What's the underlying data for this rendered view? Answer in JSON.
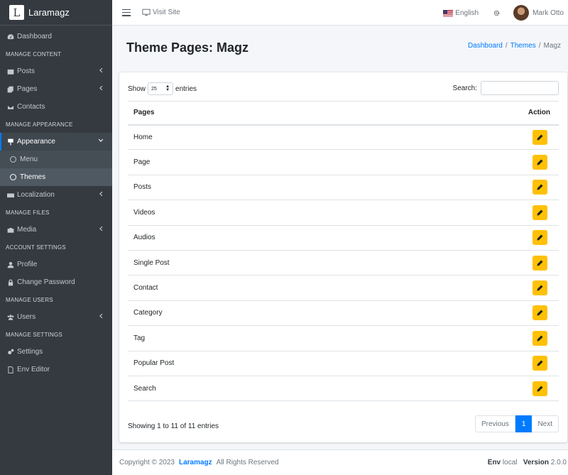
{
  "brand": {
    "logo_letter": "L",
    "name": "Laramagz"
  },
  "sidebar": {
    "dashboard": "Dashboard",
    "manage_content": "MANAGE CONTENT",
    "posts": "Posts",
    "pages": "Pages",
    "contacts": "Contacts",
    "manage_appearance": "MANAGE APPEARANCE",
    "appearance": "Appearance",
    "menu": "Menu",
    "themes": "Themes",
    "localization": "Localization",
    "manage_files": "MANAGE FILES",
    "media": "Media",
    "account_settings": "ACCOUNT SETTINGS",
    "profile": "Profile",
    "change_password": "Change Password",
    "manage_users": "MANAGE USERS",
    "users": "Users",
    "manage_settings": "MANAGE SETTINGS",
    "settings": "Settings",
    "env_editor": "Env Editor"
  },
  "topbar": {
    "visit_site": "Visit Site",
    "language": "English",
    "user_name": "Mark Otto"
  },
  "header": {
    "title": "Theme Pages: Magz",
    "breadcrumb": [
      "Dashboard",
      "Themes",
      "Magz"
    ],
    "breadcrumb_sep": "/"
  },
  "table": {
    "show_label": "Show",
    "entries_value": "25",
    "entries_label": "entries",
    "search_label": "Search:",
    "columns": [
      "Pages",
      "Action"
    ],
    "rows": [
      "Home",
      "Page",
      "Posts",
      "Videos",
      "Audios",
      "Single Post",
      "Contact",
      "Category",
      "Tag",
      "Popular Post",
      "Search"
    ],
    "info": "Showing 1 to 11 of 11 entries",
    "pager": {
      "previous": "Previous",
      "current": "1",
      "next": "Next"
    }
  },
  "footer": {
    "copyright": "Copyright © 2023",
    "brand": "Laramagz",
    "rights": "All Rights Reserved",
    "env_label": "Env",
    "env_value": "local",
    "version_label": "Version",
    "version_value": "2.0.0"
  },
  "colors": {
    "accent": "#007bff",
    "edit_button": "#ffc107",
    "sidebar_bg": "#343a40"
  }
}
